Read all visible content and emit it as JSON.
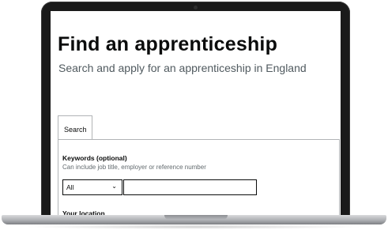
{
  "page": {
    "title": "Find an apprenticeship",
    "subtitle": "Search and apply for an apprenticeship in England"
  },
  "tabs": [
    {
      "label": "Search",
      "selected": true
    }
  ],
  "search": {
    "keywords_label": "Keywords (optional)",
    "keywords_hint": "Can include job title, employer or reference number",
    "category_select_value": "All",
    "keywords_value": "",
    "location_label": "Your location"
  },
  "icons": {
    "select_chevron": "chevron-down-icon"
  },
  "colors": {
    "text": "#0b0c0c",
    "secondary_text": "#505a5f",
    "border": "#b1b4b6"
  }
}
